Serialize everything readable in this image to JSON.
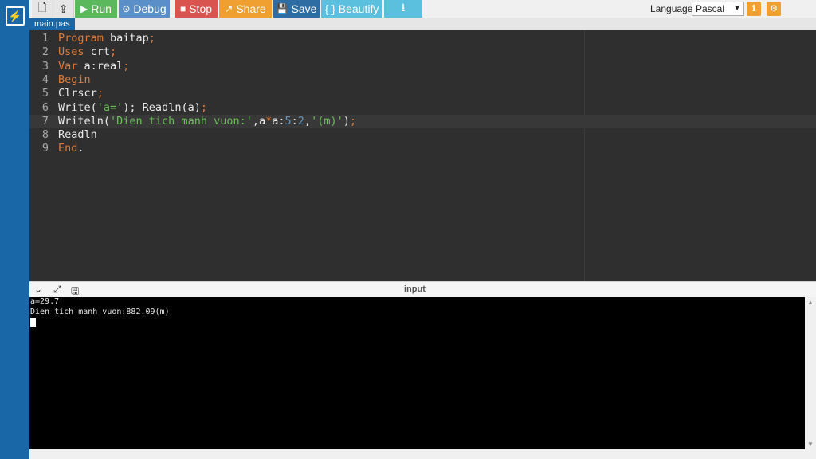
{
  "toolbar": {
    "run_label": "Run",
    "debug_label": "Debug",
    "stop_label": "Stop",
    "share_label": "Share",
    "save_label": "Save",
    "beautify_label": "{ } Beautify",
    "language_label": "Language",
    "language_value": "Pascal"
  },
  "colors": {
    "rail": "#1a67a8",
    "run": "#5cb85c",
    "debug": "#5b8fc7",
    "stop": "#d9534f",
    "share": "#f0a030",
    "save": "#2e6da4",
    "beautify": "#5bc0de",
    "download": "#5bc0de"
  },
  "editor": {
    "tab": "main.pas",
    "active_line": 7,
    "lines": [
      {
        "n": "1",
        "parts": [
          [
            "kw",
            "Program"
          ],
          [
            "id",
            " baitap"
          ],
          [
            "op",
            ";"
          ]
        ]
      },
      {
        "n": "2",
        "parts": [
          [
            "kw",
            "Uses"
          ],
          [
            "id",
            " crt"
          ],
          [
            "op",
            ";"
          ]
        ]
      },
      {
        "n": "3",
        "parts": [
          [
            "kw",
            "Var"
          ],
          [
            "id",
            " a:real"
          ],
          [
            "op",
            ";"
          ]
        ]
      },
      {
        "n": "4",
        "parts": [
          [
            "kw",
            "Begin"
          ]
        ]
      },
      {
        "n": "5",
        "parts": [
          [
            "id",
            "Clrscr"
          ],
          [
            "op",
            ";"
          ]
        ]
      },
      {
        "n": "6",
        "parts": [
          [
            "id",
            "Write("
          ],
          [
            "str",
            "'a='"
          ],
          [
            "id",
            "); Readln(a)"
          ],
          [
            "op",
            ";"
          ]
        ]
      },
      {
        "n": "7",
        "parts": [
          [
            "id",
            "Writeln("
          ],
          [
            "str",
            "'Dien tich manh vuon:'"
          ],
          [
            "id",
            ",a"
          ],
          [
            "op",
            "*"
          ],
          [
            "id",
            "a:"
          ],
          [
            "num",
            "5"
          ],
          [
            "id",
            ":"
          ],
          [
            "num",
            "2"
          ],
          [
            "id",
            ","
          ],
          [
            "str",
            "'(m)'"
          ],
          [
            "id",
            ")"
          ],
          [
            "op",
            ";"
          ]
        ]
      },
      {
        "n": "8",
        "parts": [
          [
            "id",
            "Readln"
          ]
        ]
      },
      {
        "n": "9",
        "parts": [
          [
            "kw",
            "End"
          ],
          [
            "id",
            "."
          ]
        ]
      }
    ]
  },
  "output": {
    "title": "input",
    "lines": [
      "a=29.7",
      "Dien tich manh vuon:882.09(m)"
    ]
  }
}
